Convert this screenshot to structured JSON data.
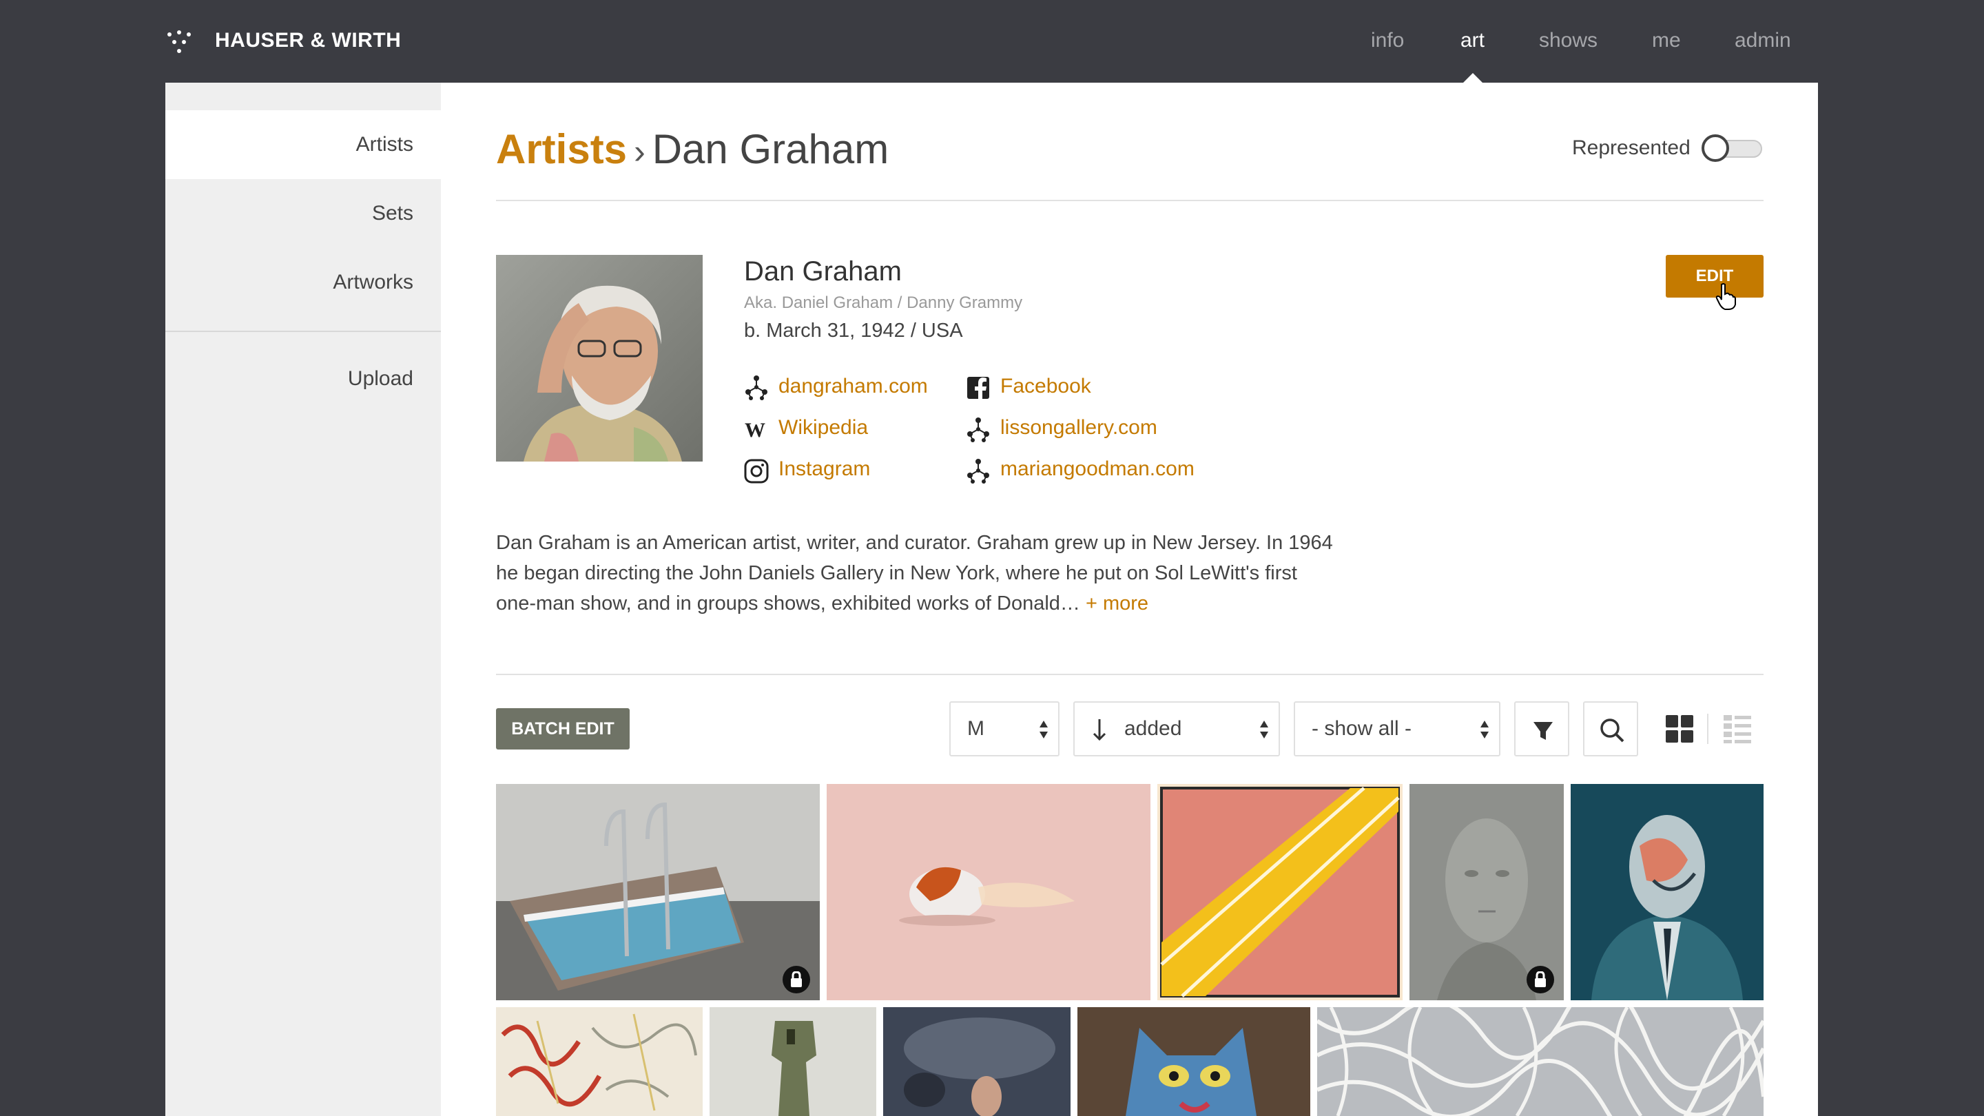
{
  "app": {
    "brand": "HAUSER & WIRTH",
    "nav": [
      {
        "label": "info"
      },
      {
        "label": "art"
      },
      {
        "label": "shows"
      },
      {
        "label": "me"
      },
      {
        "label": "admin"
      }
    ],
    "active_nav": "art"
  },
  "sidebar": {
    "items": [
      {
        "label": "Artists"
      },
      {
        "label": "Sets"
      },
      {
        "label": "Artworks"
      },
      {
        "label": "Upload"
      }
    ],
    "active": "Artists"
  },
  "header": {
    "breadcrumb_root": "Artists",
    "breadcrumb_sep": "›",
    "breadcrumb_current": "Dan Graham",
    "represented_label": "Represented",
    "represented_on": false
  },
  "artist": {
    "name": "Dan Graham",
    "aka": "Aka. Daniel Graham / Danny Grammy",
    "born": "b. March 31, 1942 / USA",
    "edit_label": "EDIT",
    "links": [
      {
        "label": "dangraham.com",
        "icon": "network-icon"
      },
      {
        "label": "Wikipedia",
        "icon": "wikipedia-icon"
      },
      {
        "label": "Instagram",
        "icon": "instagram-icon"
      },
      {
        "label": "Facebook",
        "icon": "facebook-icon"
      },
      {
        "label": "lissongallery.com",
        "icon": "network-icon"
      },
      {
        "label": "mariangoodman.com",
        "icon": "network-icon"
      }
    ],
    "bio": "Dan Graham is an American artist, writer, and curator. Graham grew up in New Jersey. In 1964 he began directing the John Daniels Gallery in New York, where he put on Sol LeWitt's first one-man show, and in groups shows, exhibited works of Donald…",
    "bio_more": "+ more"
  },
  "toolbar": {
    "batch_edit_label": "BATCH EDIT",
    "size_value": "M",
    "sort_value": "added",
    "sort_direction_icon": "arrow-down-icon",
    "filter_value": "- show all -",
    "view_mode": "grid"
  },
  "artworks": [
    {
      "name": "pool-sculpture",
      "locked": true
    },
    {
      "name": "goldfish",
      "locked": false
    },
    {
      "name": "yellow-stripe-painting",
      "locked": false
    },
    {
      "name": "ghost-face",
      "locked": true
    },
    {
      "name": "suited-figure",
      "locked": false
    },
    {
      "name": "abstract-scribble",
      "locked": false
    },
    {
      "name": "bronze-sculpture",
      "locked": false
    },
    {
      "name": "dark-mythological-painting",
      "locked": false
    },
    {
      "name": "blue-cat-painting",
      "locked": false
    },
    {
      "name": "white-line-tangle",
      "locked": false
    }
  ],
  "colors": {
    "accent": "#c47a00",
    "topbar": "#3b3c42",
    "batch_button": "#6f7366"
  }
}
